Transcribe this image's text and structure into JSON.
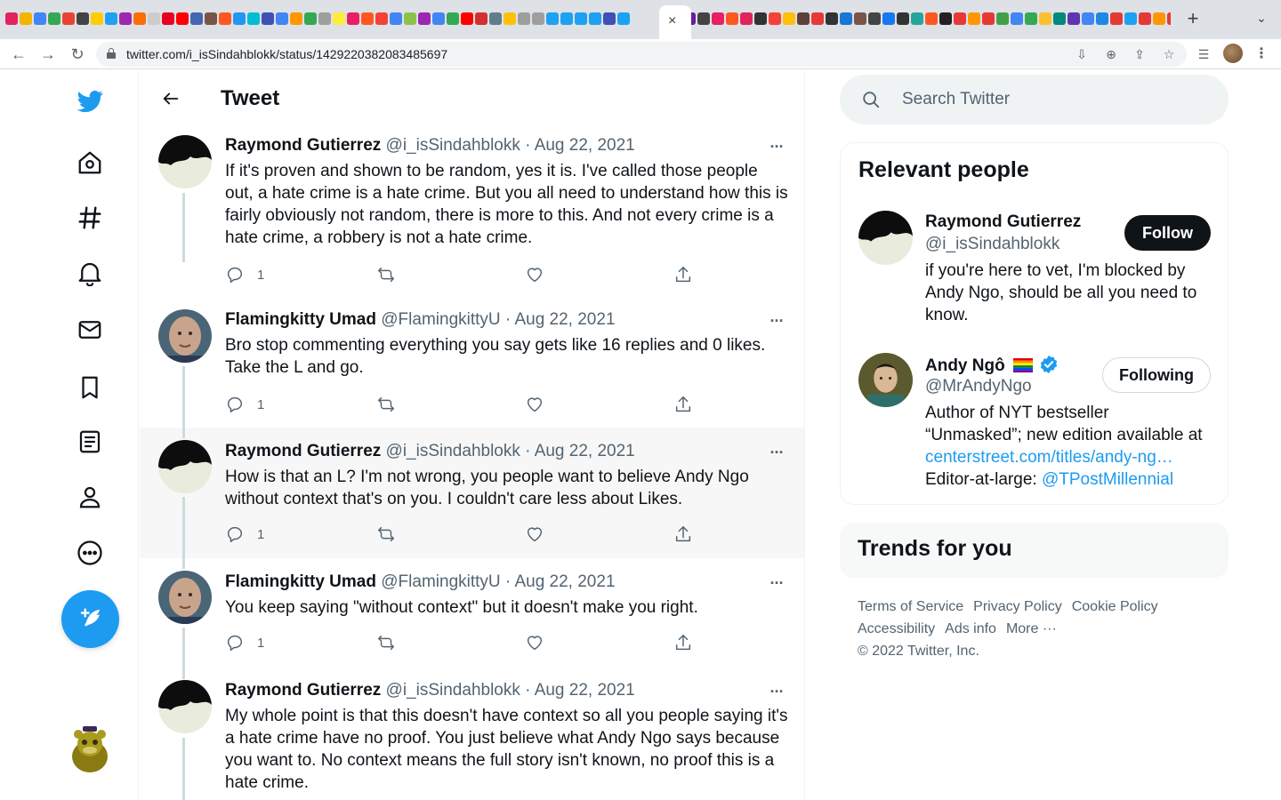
{
  "browser": {
    "tab_favicon_colors": [
      "#e0245e",
      "#f4b400",
      "#4285f4",
      "#34a853",
      "#ea4335",
      "#444444",
      "#ffcc00",
      "#1da1f2",
      "#9c27b0",
      "#ff6d00",
      "#cccccc",
      "#e60023",
      "#ff0000",
      "#4267b2",
      "#795548",
      "#ff5722",
      "#2196f3",
      "#00bcd4",
      "#3f51b5",
      "#4285f4",
      "#ff9800",
      "#34a853",
      "#9e9e9e",
      "#ffeb3b",
      "#e91e63",
      "#ff5722",
      "#f44336",
      "#4285f4",
      "#8bc34a",
      "#9c27b0",
      "#4285f4",
      "#34a853",
      "#ff0000",
      "#d32f2f",
      "#607d8b",
      "#ffc107",
      "#9e9e9e",
      "#9e9e9e",
      "#1da1f2",
      "#1da1f2",
      "#1da1f2",
      "#1da1f2",
      "#3f51b5",
      "#1da1f2"
    ],
    "tab_favicon_colors_right": [
      "#1da1f2",
      "#6a1b9a",
      "#444444",
      "#e91e63",
      "#ff5722",
      "#e0245e",
      "#333333",
      "#f44336",
      "#ffc107",
      "#5d4037",
      "#e53935",
      "#333333",
      "#1976d2",
      "#795548",
      "#444444",
      "#1877f2",
      "#333333",
      "#26a69a",
      "#ff5722",
      "#212121",
      "#e53935",
      "#ff9800",
      "#e53935",
      "#43a047",
      "#4285f4",
      "#34a853",
      "#fbc02d",
      "#00897b",
      "#5e35b1",
      "#4285f4",
      "#1e88e5",
      "#e53935",
      "#1da1f2",
      "#e53935",
      "#ff9800",
      "#e53935",
      "#555555"
    ],
    "close_tab_icon": "×",
    "new_tab_label": "+",
    "tab_menu_label": "⌄",
    "back_label": "←",
    "forward_label": "→",
    "reload_label": "↻",
    "url": "twitter.com/i_isSindahblokk/status/1429220382083485697",
    "omni_icons": [
      "⇩",
      "⊕",
      "⇪",
      "☆"
    ],
    "extensions_label": "☰",
    "menu_label": "⋮"
  },
  "main": {
    "title": "Tweet"
  },
  "tweets": [
    {
      "name": "Raymond Gutierrez",
      "meta": "@i_isSindahblokk · Aug 22, 2021",
      "more": "···",
      "lines": [
        "If it's proven and shown to be random, yes it is. I've called those people",
        "out, a hate crime is a hate crime. But you all need to understand how this is",
        "fairly obviously not random, there is more to this. And not every crime is a",
        "hate crime, a robbery is not a hate crime."
      ],
      "reply_count": "1"
    },
    {
      "name": "Flamingkitty Umad",
      "meta": "@FlamingkittyU · Aug 22, 2021",
      "more": "···",
      "lines": [
        "Bro stop commenting everything you say gets like 16 replies and 0 likes.",
        "Take the L and go."
      ],
      "reply_count": "1"
    },
    {
      "name": "Raymond Gutierrez",
      "meta": "@i_isSindahblokk · Aug 22, 2021",
      "more": "···",
      "lines": [
        "How is that an L? I'm not wrong, you people want to believe Andy Ngo",
        "without context that's on you. I couldn't care less about Likes."
      ],
      "reply_count": "1"
    },
    {
      "name": "Flamingkitty Umad",
      "meta": "@FlamingkittyU · Aug 22, 2021",
      "more": "···",
      "lines": [
        "You keep saying \"without context\" but it doesn't make you right."
      ],
      "reply_count": "1"
    },
    {
      "name": "Raymond Gutierrez",
      "meta": "@i_isSindahblokk · Aug 22, 2021",
      "more": "···",
      "lines": [
        "My whole point is that this doesn't have context so all you people saying it's",
        "a hate crime have no proof. You just believe what Andy Ngo says because",
        "you want to. No context means the full story isn't known, no proof this is a",
        "hate crime."
      ]
    }
  ],
  "search": {
    "placeholder": "Search Twitter"
  },
  "relevant_people": {
    "title": "Relevant people",
    "people": [
      {
        "name": "Raymond Gutierrez",
        "handle": "@i_isSindahblokk",
        "button": "Follow",
        "bio_lines": [
          "if you're here to vet, I'm blocked by",
          "Andy Ngo, should be all you need to",
          "know."
        ]
      },
      {
        "name": "Andy Ngô",
        "handle": "@MrAndyNgo",
        "button": "Following",
        "bio_lines": [
          "Author of NYT bestseller",
          "“Unmasked”; new edition available at"
        ],
        "bio_link": "centerstreet.com/titles/andy-ng…",
        "bio_prefix": "Editor-at-large: ",
        "bio_mention": "@TPostMillennial"
      }
    ]
  },
  "trends": {
    "title": "Trends for you"
  },
  "footer": {
    "links_row1": [
      "Terms of Service",
      "Privacy Policy",
      "Cookie Policy"
    ],
    "links_row2": [
      "Accessibility",
      "Ads info",
      "More ···"
    ],
    "copyright": "© 2022 Twitter, Inc."
  },
  "colors": {
    "accent": "#1d9bf0",
    "text": "#0f1419",
    "muted": "#536471"
  }
}
